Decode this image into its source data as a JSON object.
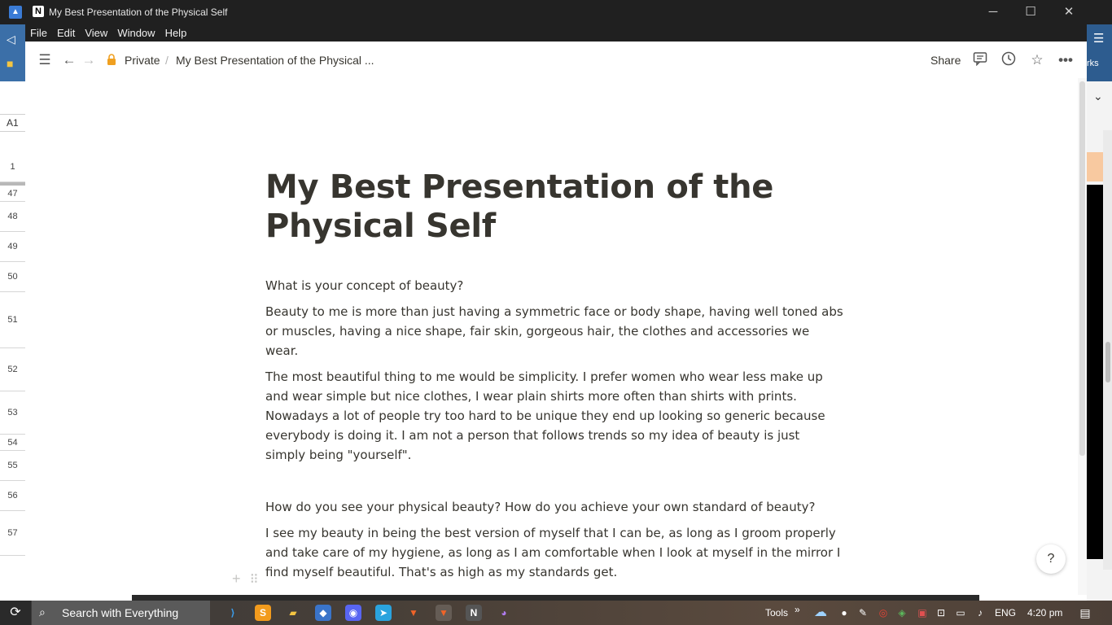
{
  "window": {
    "title": "My Best Presentation of the Physical Self",
    "minimize": "─",
    "maximize": "☐",
    "close": "✕"
  },
  "menu": [
    "File",
    "Edit",
    "View",
    "Window",
    "Help"
  ],
  "topbar": {
    "breadcrumb_private": "Private",
    "breadcrumb_separator": "/",
    "breadcrumb_page": "My Best Presentation of the Physical ...",
    "share_label": "Share"
  },
  "document": {
    "title": "My Best Presentation of the Physical Self",
    "paragraphs": [
      "What is your concept of beauty?",
      "Beauty to me is more than just having a symmetric face or body shape, having well toned abs or muscles, having a nice shape, fair skin, gorgeous hair, the clothes and accessories we wear.",
      "The most beautiful thing to me would be simplicity. I prefer women who wear less make up and wear simple but nice clothes, I wear plain shirts more often than shirts with prints. Nowadays a lot of people try too hard to be unique they end up looking so generic because everybody is doing it. I am not a person that follows trends so my idea of beauty is just simply being \"yourself\".",
      "",
      "How do you see your physical beauty? How do you achieve your own standard of beauty?",
      "I see my beauty in being the best version of myself that I can be, as long as I groom properly and take care of my hygiene, as long as I am comfortable when I look at myself in the mirror I find myself beautiful. That's as high as my standards get."
    ]
  },
  "help_label": "?",
  "background_app": {
    "cell_ref": "A1",
    "right_label": "rks",
    "rows": [
      "1",
      "47",
      "48",
      "49",
      "50",
      "51",
      "52",
      "53",
      "54",
      "55",
      "56",
      "57"
    ]
  },
  "taskbar": {
    "search_label": "Search with Everything",
    "tools_label": "Tools",
    "tools_chevron": "»",
    "language": "ENG",
    "time": "4:20 pm"
  },
  "colors": {
    "accent_lock": "#f0a020",
    "text": "#37352f",
    "titlebar": "#202020"
  }
}
